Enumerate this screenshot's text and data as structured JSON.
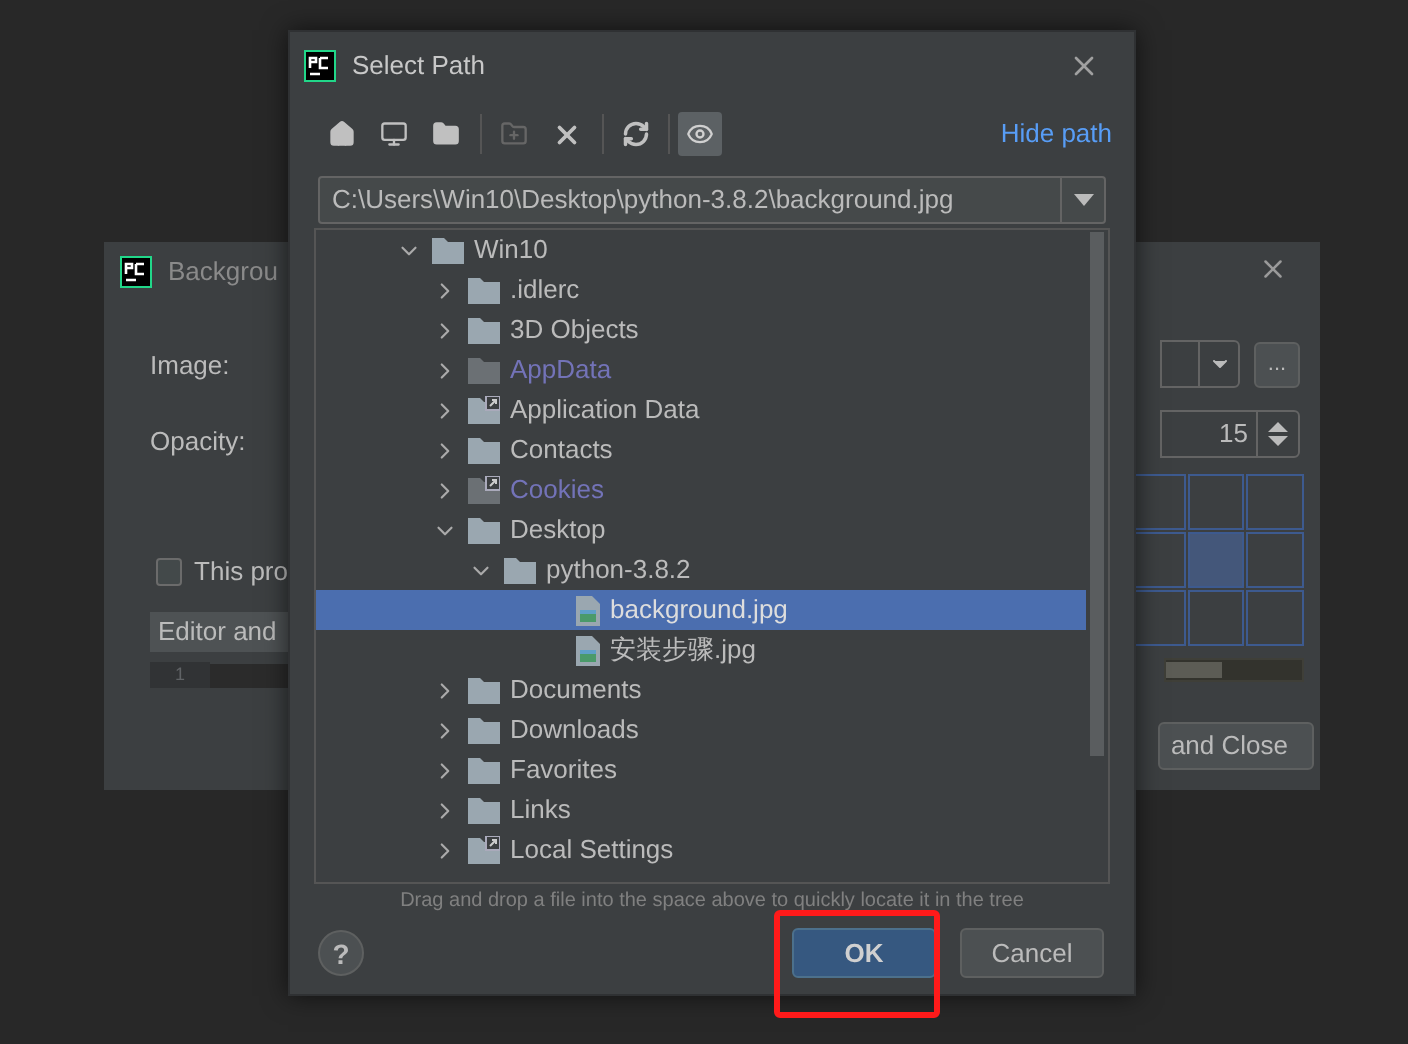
{
  "back_dialog": {
    "title": "Backgrou",
    "image_label": "Image:",
    "opacity_label": "Opacity:",
    "opacity_value": "15",
    "browse_button": "...",
    "checkbox": {
      "label": "This pro",
      "checked": false
    },
    "tab": "Editor and",
    "line_number": "1",
    "close_button": "and Close",
    "anchor_cells": [
      {
        "selected": false
      },
      {
        "selected": false
      },
      {
        "selected": false
      },
      {
        "selected": false
      },
      {
        "selected": true
      },
      {
        "selected": false
      },
      {
        "selected": false
      },
      {
        "selected": false
      },
      {
        "selected": false
      }
    ]
  },
  "dialog": {
    "title": "Select Path",
    "hide_path_link": "Hide path",
    "path": "C:\\Users\\Win10\\Desktop\\python-3.8.2\\background.jpg",
    "tree": [
      {
        "name": "Win10",
        "kind": "folder",
        "expanded": true,
        "hidden": false,
        "link": false,
        "children": [
          {
            "name": ".idlerc",
            "kind": "folder",
            "expanded": false,
            "hidden": false,
            "link": false
          },
          {
            "name": "3D Objects",
            "kind": "folder",
            "expanded": false,
            "hidden": false,
            "link": false
          },
          {
            "name": "AppData",
            "kind": "folder",
            "expanded": false,
            "hidden": true,
            "link": false
          },
          {
            "name": "Application Data",
            "kind": "folder",
            "expanded": false,
            "hidden": false,
            "link": true
          },
          {
            "name": "Contacts",
            "kind": "folder",
            "expanded": false,
            "hidden": false,
            "link": false
          },
          {
            "name": "Cookies",
            "kind": "folder",
            "expanded": false,
            "hidden": true,
            "link": true
          },
          {
            "name": "Desktop",
            "kind": "folder",
            "expanded": true,
            "hidden": false,
            "link": false,
            "children": [
              {
                "name": "python-3.8.2",
                "kind": "folder",
                "expanded": true,
                "hidden": false,
                "link": false,
                "children": [
                  {
                    "name": "background.jpg",
                    "kind": "image",
                    "selected": true
                  },
                  {
                    "name": "安装步骤.jpg",
                    "kind": "image",
                    "selected": false
                  }
                ]
              }
            ]
          },
          {
            "name": "Documents",
            "kind": "folder",
            "expanded": false,
            "hidden": false,
            "link": false
          },
          {
            "name": "Downloads",
            "kind": "folder",
            "expanded": false,
            "hidden": false,
            "link": false
          },
          {
            "name": "Favorites",
            "kind": "folder",
            "expanded": false,
            "hidden": false,
            "link": false
          },
          {
            "name": "Links",
            "kind": "folder",
            "expanded": false,
            "hidden": false,
            "link": false
          },
          {
            "name": "Local Settings",
            "kind": "folder",
            "expanded": false,
            "hidden": false,
            "link": true
          }
        ]
      }
    ],
    "hint": "Drag and drop a file into the space above to quickly locate it in the tree",
    "help_button": "?",
    "buttons": [
      {
        "label": "OK",
        "default": true,
        "highlighted": true
      },
      {
        "label": "Cancel",
        "default": false,
        "highlighted": false
      }
    ]
  }
}
